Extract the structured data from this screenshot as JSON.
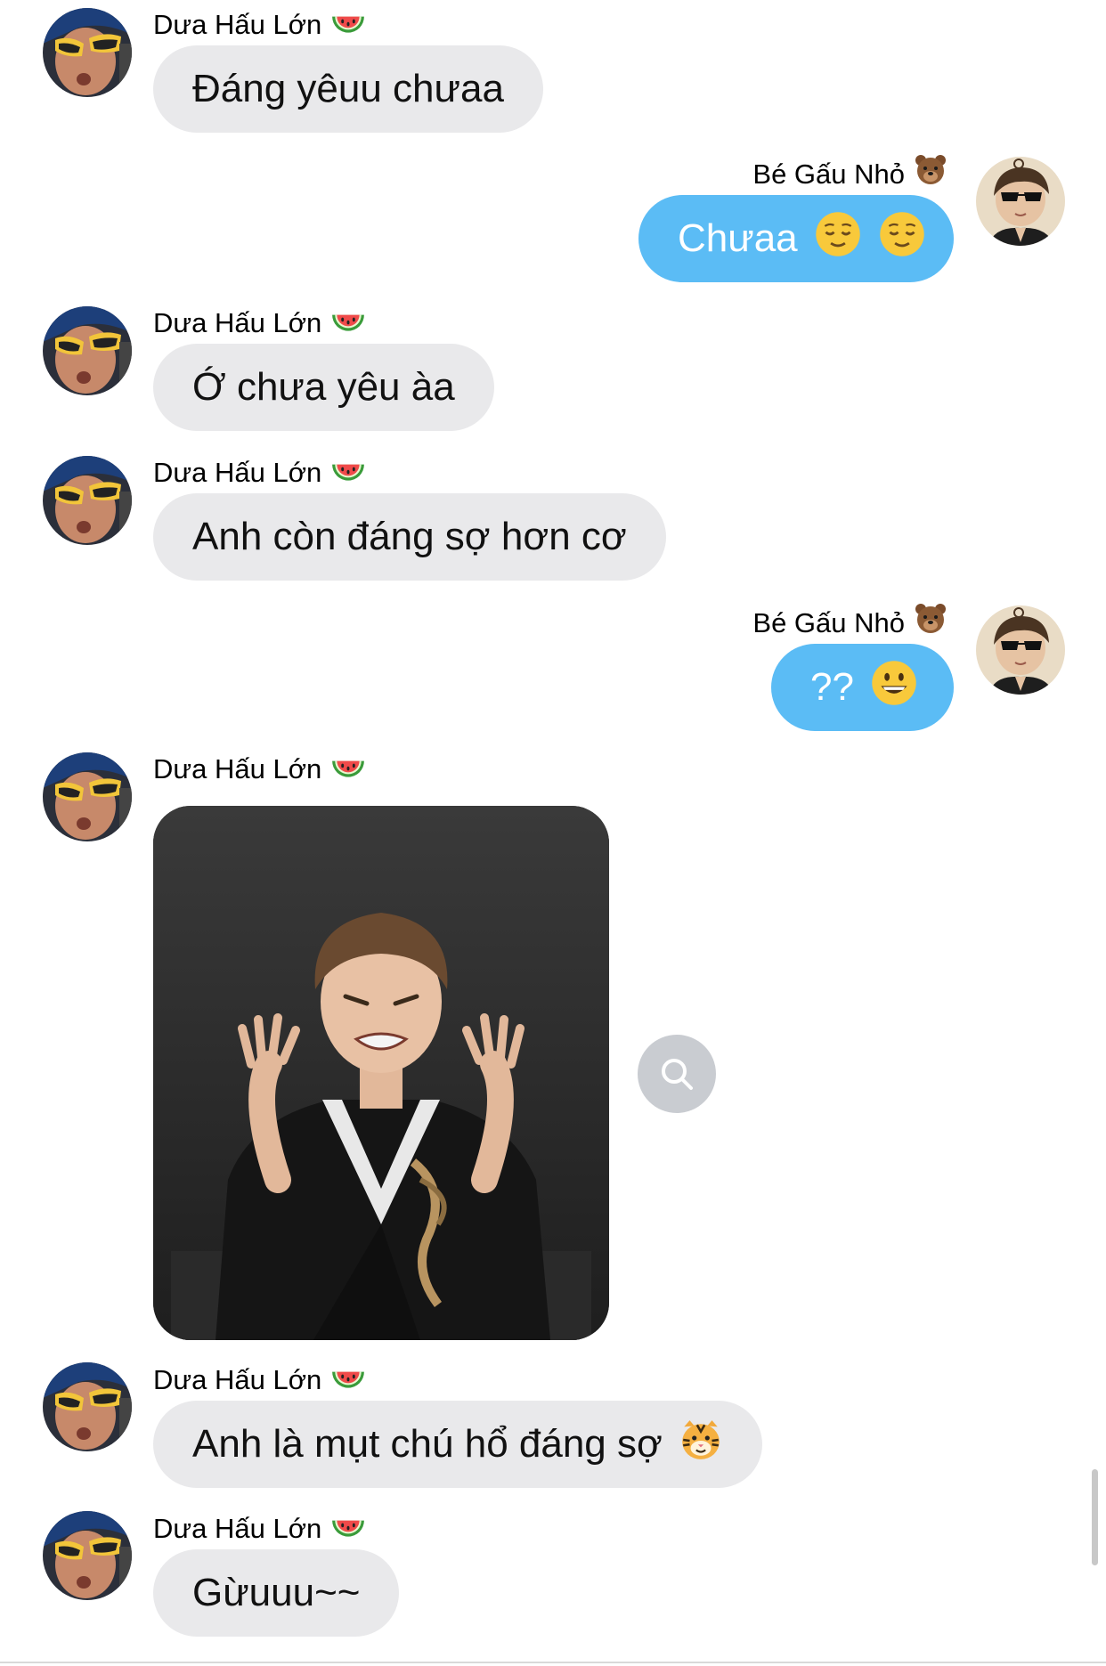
{
  "contacts": {
    "other": {
      "name": "Dưa Hấu Lớn"
    },
    "me": {
      "name": "Bé Gấu Nhỏ"
    }
  },
  "messages": [
    {
      "sender": "Dưa Hấu Lớn",
      "direction": "incoming",
      "text": "Đáng yêuu chưaa"
    },
    {
      "sender": "Bé Gấu Nhỏ",
      "direction": "outgoing",
      "text": "Chưaa",
      "emojis": [
        "relieved-face",
        "relieved-face"
      ]
    },
    {
      "sender": "Dưa Hấu Lớn",
      "direction": "incoming",
      "text": "Ớ chưa yêu àa"
    },
    {
      "sender": "Dưa Hấu Lớn",
      "direction": "incoming",
      "text": "Anh còn đáng sợ hơn cơ"
    },
    {
      "sender": "Bé Gấu Nhỏ",
      "direction": "outgoing",
      "text": "??",
      "emojis": [
        "grinning-face"
      ]
    },
    {
      "sender": "Dưa Hấu Lớn",
      "direction": "incoming",
      "type": "image"
    },
    {
      "sender": "Dưa Hấu Lớn",
      "direction": "incoming",
      "text": "Anh là mụt chú hổ đáng sợ",
      "emojis": [
        "tiger-face"
      ]
    },
    {
      "sender": "Dưa Hấu Lớn",
      "direction": "incoming",
      "text": "Gừuuu~~"
    }
  ],
  "icons": {
    "other_name_emoji": "watermelon-icon",
    "me_name_emoji": "bear-icon",
    "image_action": "search-icon"
  },
  "colors": {
    "incoming_bubble": "#e9e9eb",
    "outgoing_bubble": "#5bbcf5",
    "zoom_button": "#c9ccd1"
  }
}
